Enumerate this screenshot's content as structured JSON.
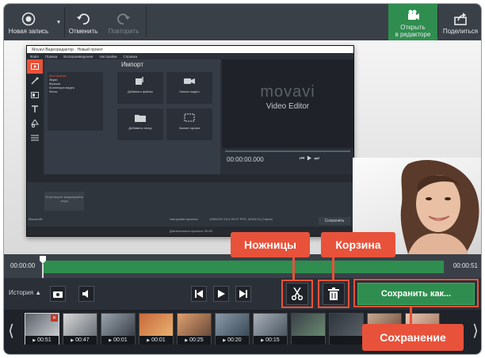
{
  "toolbar": {
    "new_recording": "Новая запись",
    "undo": "Отменить",
    "redo": "Повторить",
    "open_editor_line1": "Открыть",
    "open_editor_line2": "в редакторе",
    "share": "Поделиться"
  },
  "screenshot": {
    "window_title": "Movavi Видеоредактор - Новый проект",
    "menu": [
      "Файл",
      "Правка",
      "Воспроизведение",
      "Настройки",
      "Справка"
    ],
    "import_title": "Импорт",
    "list_items": [
      "Мои файлы",
      "Звуки",
      "Музыка",
      "Коллекция видео",
      "Фоны"
    ],
    "tiles": {
      "add_files": "Добавить файлы",
      "record_video": "Запись видео",
      "add_folder": "Добавить папку",
      "screen_capture": "Захват экрана"
    },
    "logo": "movavi",
    "product": "Video Editor",
    "time": "00:00:00.000",
    "drop_hint": "Перетащите медиафайлы сюда",
    "scale_label": "Масштаб:",
    "project_settings": "Настройки проекта:",
    "project_settings_value": "1280x720 16:9 29.97 FPS, 44100 Гц Стерео",
    "duration_label": "Длительность проекта:",
    "duration_value": "00:00",
    "save_label": "Сохранить"
  },
  "timeline": {
    "start": "00:00:00",
    "end": "00:00:51"
  },
  "controls": {
    "history": "История",
    "save_as": "Сохранить как..."
  },
  "strip": {
    "thumbs": [
      {
        "dur": "00:51",
        "colors": [
          "#5a6068",
          "#c8ccd0"
        ]
      },
      {
        "dur": "00:47",
        "colors": [
          "#d8d8d8",
          "#6a7078"
        ]
      },
      {
        "dur": "00:01",
        "colors": [
          "#9aa4ae",
          "#3a4048"
        ]
      },
      {
        "dur": "00:01",
        "colors": [
          "#c96a3a",
          "#e8b070"
        ]
      },
      {
        "dur": "00:25",
        "colors": [
          "#e0a070",
          "#6a4a3a"
        ]
      },
      {
        "dur": "00:20",
        "colors": [
          "#8a9aa8",
          "#3a4a58"
        ]
      },
      {
        "dur": "00:15",
        "colors": [
          "#a8b0b8",
          "#4a5560"
        ]
      },
      {
        "dur": "",
        "colors": [
          "#3a4048",
          "#6a8a70"
        ]
      },
      {
        "dur": "",
        "colors": [
          "#2f353d",
          "#5a6068"
        ]
      },
      {
        "dur": "",
        "colors": [
          "#c8a890",
          "#6a4a3a"
        ]
      },
      {
        "dur": "",
        "colors": [
          "#e8c8b0",
          "#a07060"
        ]
      }
    ]
  },
  "callouts": {
    "scissors": "Ножницы",
    "trash": "Корзина",
    "save": "Сохранение"
  },
  "colors": {
    "accent_green": "#2f8e4f",
    "callout": "#e8523a",
    "toolbar": "#3a4048"
  }
}
